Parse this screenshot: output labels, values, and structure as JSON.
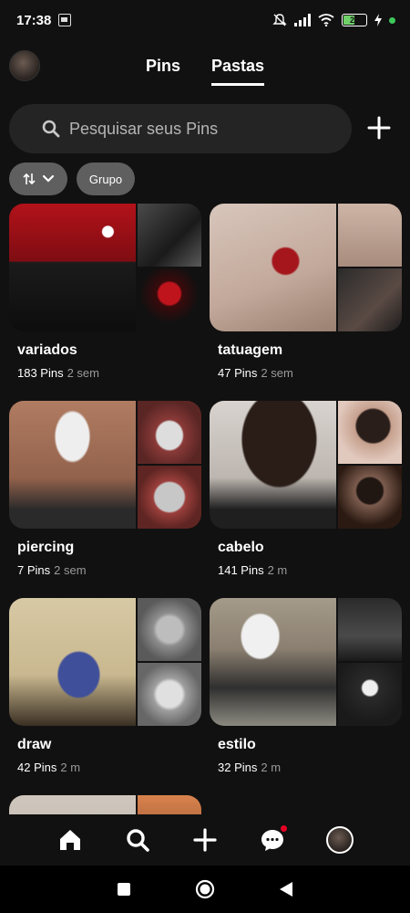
{
  "status_bar": {
    "time": "17:38",
    "battery": "29",
    "icons": [
      "calendar-icon",
      "mute-icon",
      "signal-icon",
      "wifi-icon",
      "battery-icon",
      "charging-icon",
      "dot-icon"
    ]
  },
  "header": {
    "tabs": [
      {
        "label": "Pins",
        "active": false
      },
      {
        "label": "Pastas",
        "active": true
      }
    ]
  },
  "search": {
    "placeholder": "Pesquisar seus Pins"
  },
  "filters": {
    "sort_icon": "sort-arrows-icon",
    "group_label": "Grupo"
  },
  "boards": [
    {
      "name": "variados",
      "pins": "183 Pins",
      "ago": "2 sem"
    },
    {
      "name": "tatuagem",
      "pins": "47 Pins",
      "ago": "2 sem"
    },
    {
      "name": "piercing",
      "pins": "7 Pins",
      "ago": "2 sem"
    },
    {
      "name": "cabelo",
      "pins": "141 Pins",
      "ago": "2 m"
    },
    {
      "name": "draw",
      "pins": "42 Pins",
      "ago": "2 m"
    },
    {
      "name": "estilo",
      "pins": "32 Pins",
      "ago": "2 m"
    }
  ],
  "bottom_nav": [
    "home-icon",
    "search-icon",
    "create-icon",
    "messages-icon",
    "profile-avatar"
  ],
  "colors": {
    "background": "#111111",
    "search_bg": "#242424",
    "chip_bg": "#5f5f5f",
    "notification": "#e60023"
  }
}
